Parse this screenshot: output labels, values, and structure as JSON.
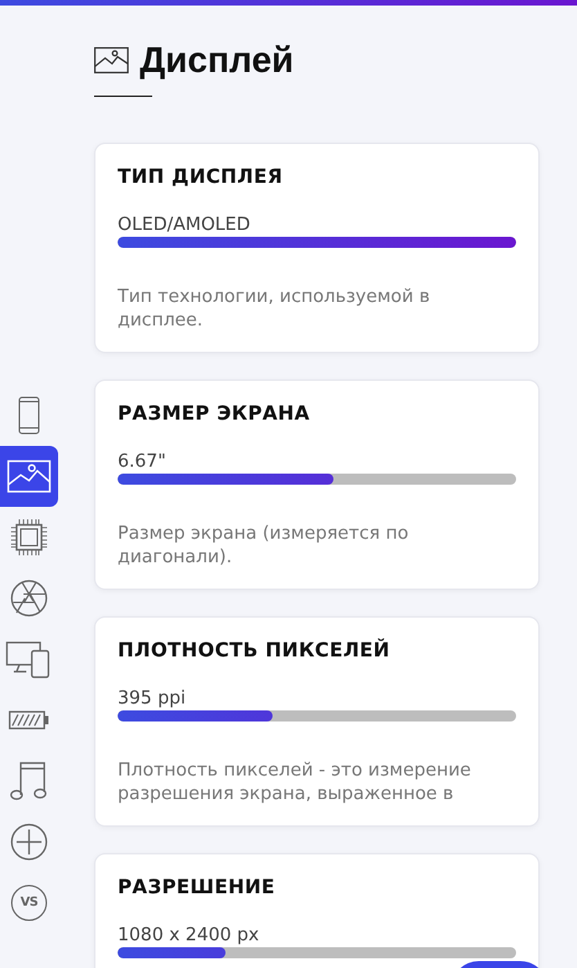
{
  "page": {
    "title": "Дисплей"
  },
  "sidebar": [
    {
      "selected": false
    },
    {
      "selected": true
    },
    {
      "selected": false
    },
    {
      "selected": false
    },
    {
      "selected": false
    },
    {
      "selected": false
    },
    {
      "selected": false
    },
    {
      "selected": false
    },
    {
      "selected": false,
      "label": "VS"
    }
  ],
  "specs": [
    {
      "title": "ТИП ДИСПЛЕЯ",
      "value": "OLED/AMOLED",
      "level": 1.0,
      "description": "Тип технологии, используемой в дисплее."
    },
    {
      "title": "РАЗМЕР ЭКРАНА",
      "value": "6.67\"",
      "level": 0.54,
      "description": "Размер экрана (измеряется по диагонали)."
    },
    {
      "title": "ПЛОТНОСТЬ ПИКСЕЛЕЙ",
      "value": "395 ppi",
      "level": 0.39,
      "description": "Плотность пикселей - это измерение разрешения экрана, выраженное в"
    },
    {
      "title": "РАЗРЕШЕНИЕ",
      "value": "1080 x 2400 px",
      "level": 0.27
    }
  ]
}
